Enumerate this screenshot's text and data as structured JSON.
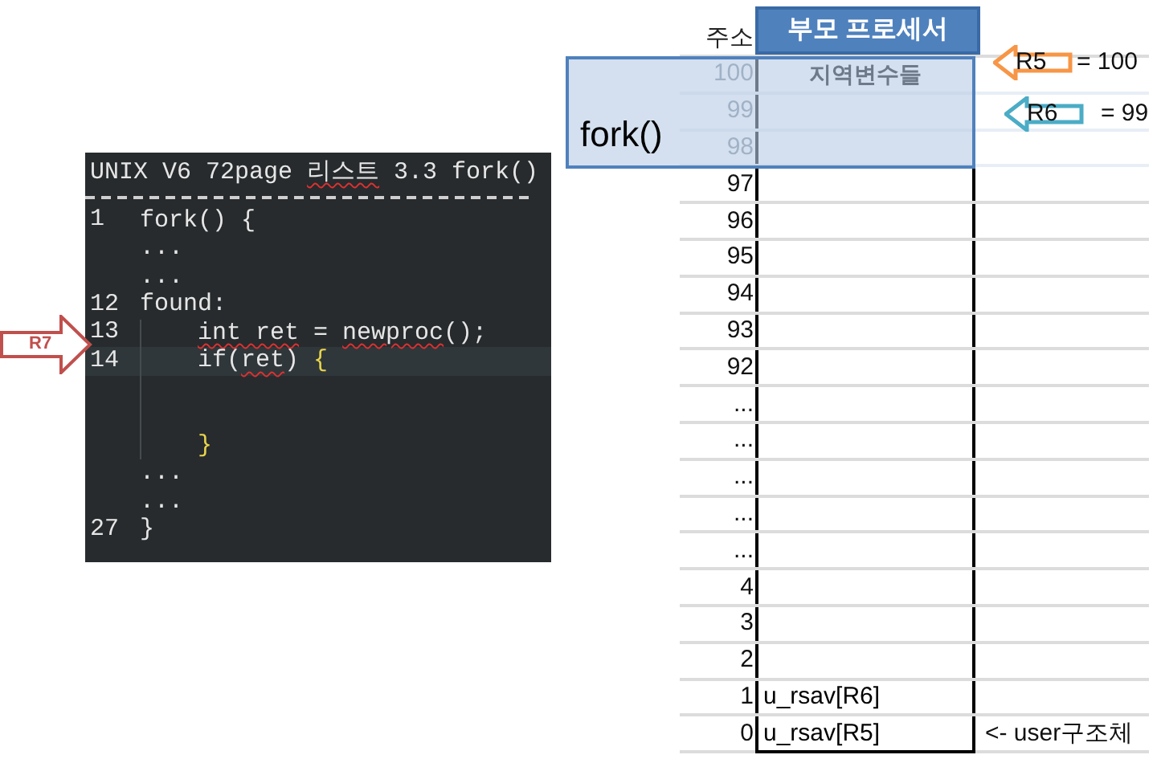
{
  "code_panel": {
    "title": [
      {
        "text": "UNIX V6 72page ",
        "kind": "plain"
      },
      {
        "text": "리스트",
        "kind": "flagged"
      },
      {
        "text": " 3.3 fork()",
        "kind": "plain"
      }
    ],
    "lines": [
      {
        "number": "1",
        "highlighted": false,
        "indented": false,
        "tokens": [
          {
            "text": "fork() {",
            "kind": "plain"
          }
        ]
      },
      {
        "highlighted": false,
        "indented": false,
        "tokens": [
          {
            "text": "...",
            "kind": "plain"
          }
        ]
      },
      {
        "highlighted": false,
        "indented": false,
        "tokens": [
          {
            "text": "...",
            "kind": "plain"
          }
        ]
      },
      {
        "number": "12",
        "highlighted": false,
        "indented": false,
        "tokens": [
          {
            "text": "found:",
            "kind": "plain"
          }
        ]
      },
      {
        "number": "13",
        "highlighted": false,
        "indented": true,
        "tokens": [
          {
            "text": "int ret",
            "kind": "flagged"
          },
          {
            "text": " = ",
            "kind": "plain"
          },
          {
            "text": "newproc",
            "kind": "flagged"
          },
          {
            "text": "();",
            "kind": "plain"
          }
        ]
      },
      {
        "number": "14",
        "highlighted": true,
        "indented": true,
        "tokens": [
          {
            "text": "if(",
            "kind": "plain"
          },
          {
            "text": "ret",
            "kind": "flagged"
          },
          {
            "text": ") ",
            "kind": "plain"
          },
          {
            "text": "{",
            "kind": "bracket"
          }
        ]
      },
      {
        "highlighted": false,
        "indented": true
      },
      {
        "highlighted": false,
        "indented": true
      },
      {
        "highlighted": false,
        "indented": true,
        "tokens": [
          {
            "text": "}",
            "kind": "bracket"
          }
        ]
      },
      {
        "highlighted": false,
        "indented": false,
        "tokens": [
          {
            "text": "...",
            "kind": "plain"
          }
        ]
      },
      {
        "highlighted": false,
        "indented": false,
        "tokens": [
          {
            "text": "...",
            "kind": "plain"
          }
        ]
      },
      {
        "number": "27",
        "highlighted": false,
        "indented": false,
        "tokens": [
          {
            "text": "}",
            "kind": "plain"
          }
        ]
      }
    ],
    "pointer": {
      "label": "R7",
      "color": "#c0504d"
    }
  },
  "sheet": {
    "address_header": "주소",
    "column_header": "부모 프로세서",
    "rows": [
      {
        "address": "100",
        "kind": "label",
        "value": "지역변수들",
        "in_frame": true
      },
      {
        "address": "99",
        "kind": "empty",
        "in_frame": true
      },
      {
        "address": "98",
        "kind": "empty",
        "in_frame": true
      },
      {
        "address": "97",
        "kind": "empty",
        "in_frame": false
      },
      {
        "address": "96",
        "kind": "empty",
        "in_frame": false
      },
      {
        "address": "95",
        "kind": "empty",
        "in_frame": false
      },
      {
        "address": "94",
        "kind": "empty",
        "in_frame": false
      },
      {
        "address": "93",
        "kind": "empty",
        "in_frame": false
      },
      {
        "address": "92",
        "kind": "empty",
        "in_frame": false
      },
      {
        "address": "...",
        "kind": "empty",
        "in_frame": false
      },
      {
        "address": "...",
        "kind": "empty",
        "in_frame": false
      },
      {
        "address": "...",
        "kind": "empty",
        "in_frame": false
      },
      {
        "address": "...",
        "kind": "empty",
        "in_frame": false
      },
      {
        "address": "...",
        "kind": "empty",
        "in_frame": false
      },
      {
        "address": "4",
        "kind": "empty",
        "in_frame": false
      },
      {
        "address": "3",
        "kind": "empty",
        "in_frame": false
      },
      {
        "address": "2",
        "kind": "empty",
        "in_frame": false
      },
      {
        "address": "1",
        "kind": "entry",
        "value": "u_rsav[R6]",
        "in_frame": false
      },
      {
        "address": "0",
        "kind": "entry",
        "value": "u_rsav[R5]",
        "in_frame": false,
        "note": "<- user구조체"
      }
    ],
    "frame": {
      "label": "fork()"
    },
    "registers": [
      {
        "name": "R5",
        "value": "= 100",
        "color": "#f79646"
      },
      {
        "name": "R6",
        "value": "= 99",
        "color": "#4bacc6"
      }
    ]
  }
}
